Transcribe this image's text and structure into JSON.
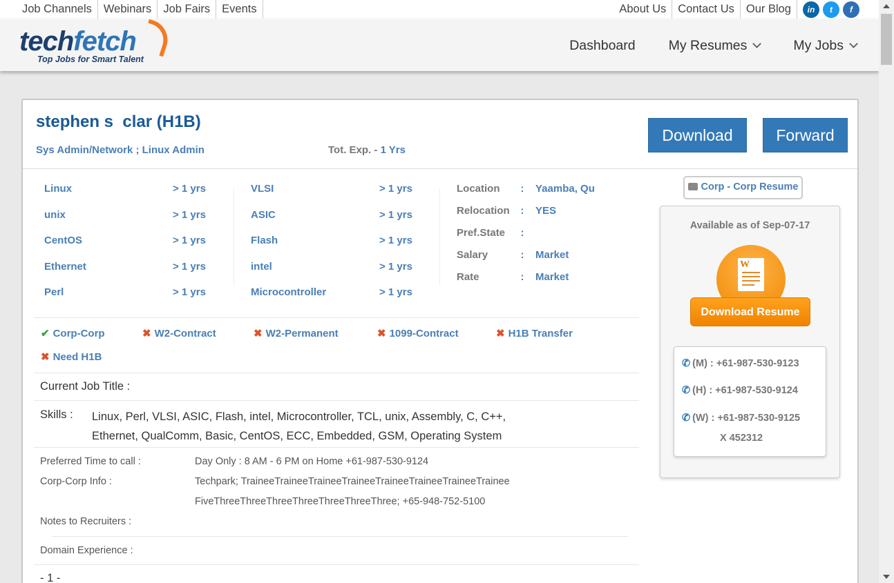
{
  "topnav": {
    "links": [
      "Job Channels",
      "Webinars",
      "Job Fairs",
      "Events"
    ],
    "right_links": [
      "About Us",
      "Contact Us",
      "Our Blog"
    ],
    "social": {
      "linkedin": "in",
      "twitter": "t",
      "facebook": "f"
    }
  },
  "brand": {
    "name_a": "tech",
    "name_b": "fetch",
    "tagline": "Top Jobs for Smart Talent"
  },
  "mainnav": {
    "dashboard": "Dashboard",
    "resumes": "My Resumes",
    "jobs": "My Jobs"
  },
  "profile": {
    "name": "stephen s  clar (H1B)",
    "role": "Sys Admin/Network ; Linux Admin",
    "tot_exp_label": "Tot. Exp. - ",
    "tot_exp_value": "1 Yrs",
    "download_label": "Download",
    "forward_label": "Forward"
  },
  "skills_col1": [
    {
      "name": "Linux",
      "years": "> 1 yrs"
    },
    {
      "name": "unix",
      "years": "> 1 yrs"
    },
    {
      "name": "CentOS",
      "years": "> 1 yrs"
    },
    {
      "name": "Ethernet",
      "years": "> 1 yrs"
    },
    {
      "name": "Perl",
      "years": "> 1 yrs"
    }
  ],
  "skills_col2": [
    {
      "name": "VLSI",
      "years": "> 1 yrs"
    },
    {
      "name": "ASIC",
      "years": "> 1 yrs"
    },
    {
      "name": "Flash",
      "years": "> 1 yrs"
    },
    {
      "name": "intel",
      "years": "> 1 yrs"
    },
    {
      "name": "Microcontroller",
      "years": "> 1 yrs"
    }
  ],
  "info": [
    {
      "key": "Location",
      "value": "Yaamba, Qu"
    },
    {
      "key": "Relocation",
      "value": "YES"
    },
    {
      "key": "Pref.State",
      "value": ""
    },
    {
      "key": "Salary",
      "value": "Market"
    },
    {
      "key": "Rate",
      "value": "Market"
    }
  ],
  "employment": [
    {
      "label": "Corp-Corp",
      "ok": true
    },
    {
      "label": "W2-Contract",
      "ok": false
    },
    {
      "label": "W2-Permanent",
      "ok": false
    },
    {
      "label": "1099-Contract",
      "ok": false
    },
    {
      "label": "H1B Transfer",
      "ok": false
    },
    {
      "label": "Need H1B",
      "ok": false
    }
  ],
  "details": {
    "current_title_label": "Current Job Title :",
    "skills_label": "Skills :",
    "skills_line1": "Linux, Perl, VLSI, ASIC, Flash, intel, Microcontroller, TCL, unix, Assembly, C, C++,",
    "skills_line2": "Ethernet, QualComm, Basic, CentOS, ECC, Embedded, GSM, Operating System",
    "pref_time_label": "Preferred Time to call :",
    "pref_time_value": "Day Only : 8 AM - 6 PM on Home +61-987-530-9124",
    "corp_info_label": "Corp-Corp Info :",
    "corp_info_line1": "Techpark; TraineeTraineeTraineeTraineeTraineeTraineeTraineeTrainee",
    "corp_info_line2": "FiveThreeThreeThreeThreeThreeThreeThree; +65-948-752-5100",
    "notes_label": "Notes to Recruiters :",
    "domain_label": "Domain Experience :",
    "page_marker": "- 1 -"
  },
  "sidebar": {
    "corp_resume": "Corp - Corp Resume",
    "available": "Available as of Sep-07-17",
    "doc_letter": "W",
    "download_resume": "Download Resume",
    "phones": [
      {
        "label": "(M) : +61-987-530-9123"
      },
      {
        "label": "(H) : +61-987-530-9124"
      },
      {
        "label": "(W) : +61-987-530-9125"
      }
    ],
    "extension": "X 452312"
  }
}
